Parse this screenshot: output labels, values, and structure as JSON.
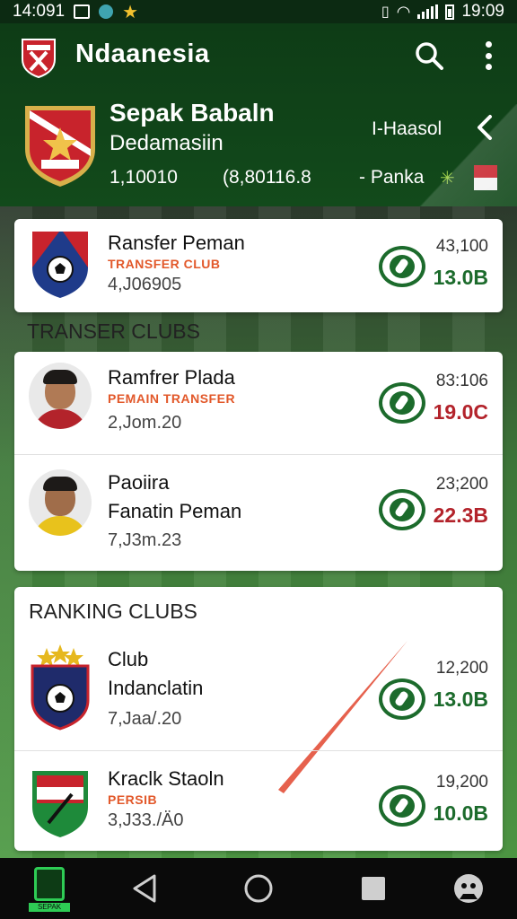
{
  "status_bar": {
    "time_left": "14:091",
    "time_right": "19:09"
  },
  "app_bar": {
    "title": "Ndaanesia",
    "icons": [
      "app-crest-icon",
      "search-icon",
      "more-vert-icon"
    ]
  },
  "club_header": {
    "name": "Sepak Babaln",
    "country": "Dedamasiin",
    "stat_1": "1,10010",
    "stat_2": "(8,80116.8",
    "link": "I-Haasol",
    "rank_label": "- Panka",
    "flag_colors": [
      "#c8232c",
      "#f2f2f2"
    ]
  },
  "featured_transfer": {
    "name": "Ransfer Peman",
    "tag": "TRANSFER CLUB",
    "sub": "4,J06905",
    "fee": "43,100",
    "value": "13.0B",
    "value_color": "#1c6b2c"
  },
  "transfer_section": {
    "title": "TRANSER CLUBS",
    "items": [
      {
        "name": "Ramfrer Plada",
        "tag": "PEMAIN TRANSFER",
        "sub": "2,Jom.20",
        "fee": "83:106",
        "value": "19.0C",
        "value_color": "#b3232b"
      },
      {
        "name_line1": "Paoiira",
        "name_line2": "Fanatin Peman",
        "sub": "7,J3m.23",
        "fee": "23;200",
        "value": "22.3B",
        "value_color": "#b3232b"
      }
    ]
  },
  "ranking_section": {
    "title": "RANKING CLUBS",
    "items": [
      {
        "name_line1": "Club",
        "name_line2": "Indanclatin",
        "sub": "7,Jaa/.20",
        "fee": "12,200",
        "value": "13.0B",
        "value_color": "#1c6b2c"
      },
      {
        "name": "Kraclk Staoln",
        "tag": "PERSIB",
        "sub": "3,J33./Ä0",
        "fee": "19,200",
        "value": "10.0B",
        "value_color": "#1c6b2c"
      }
    ]
  },
  "nav_bar": {
    "home_label": "SEPAK BOLA",
    "icons": [
      "app-home-icon",
      "back-triangle-icon",
      "home-circle-icon",
      "recents-square-icon",
      "profile-icon"
    ]
  }
}
